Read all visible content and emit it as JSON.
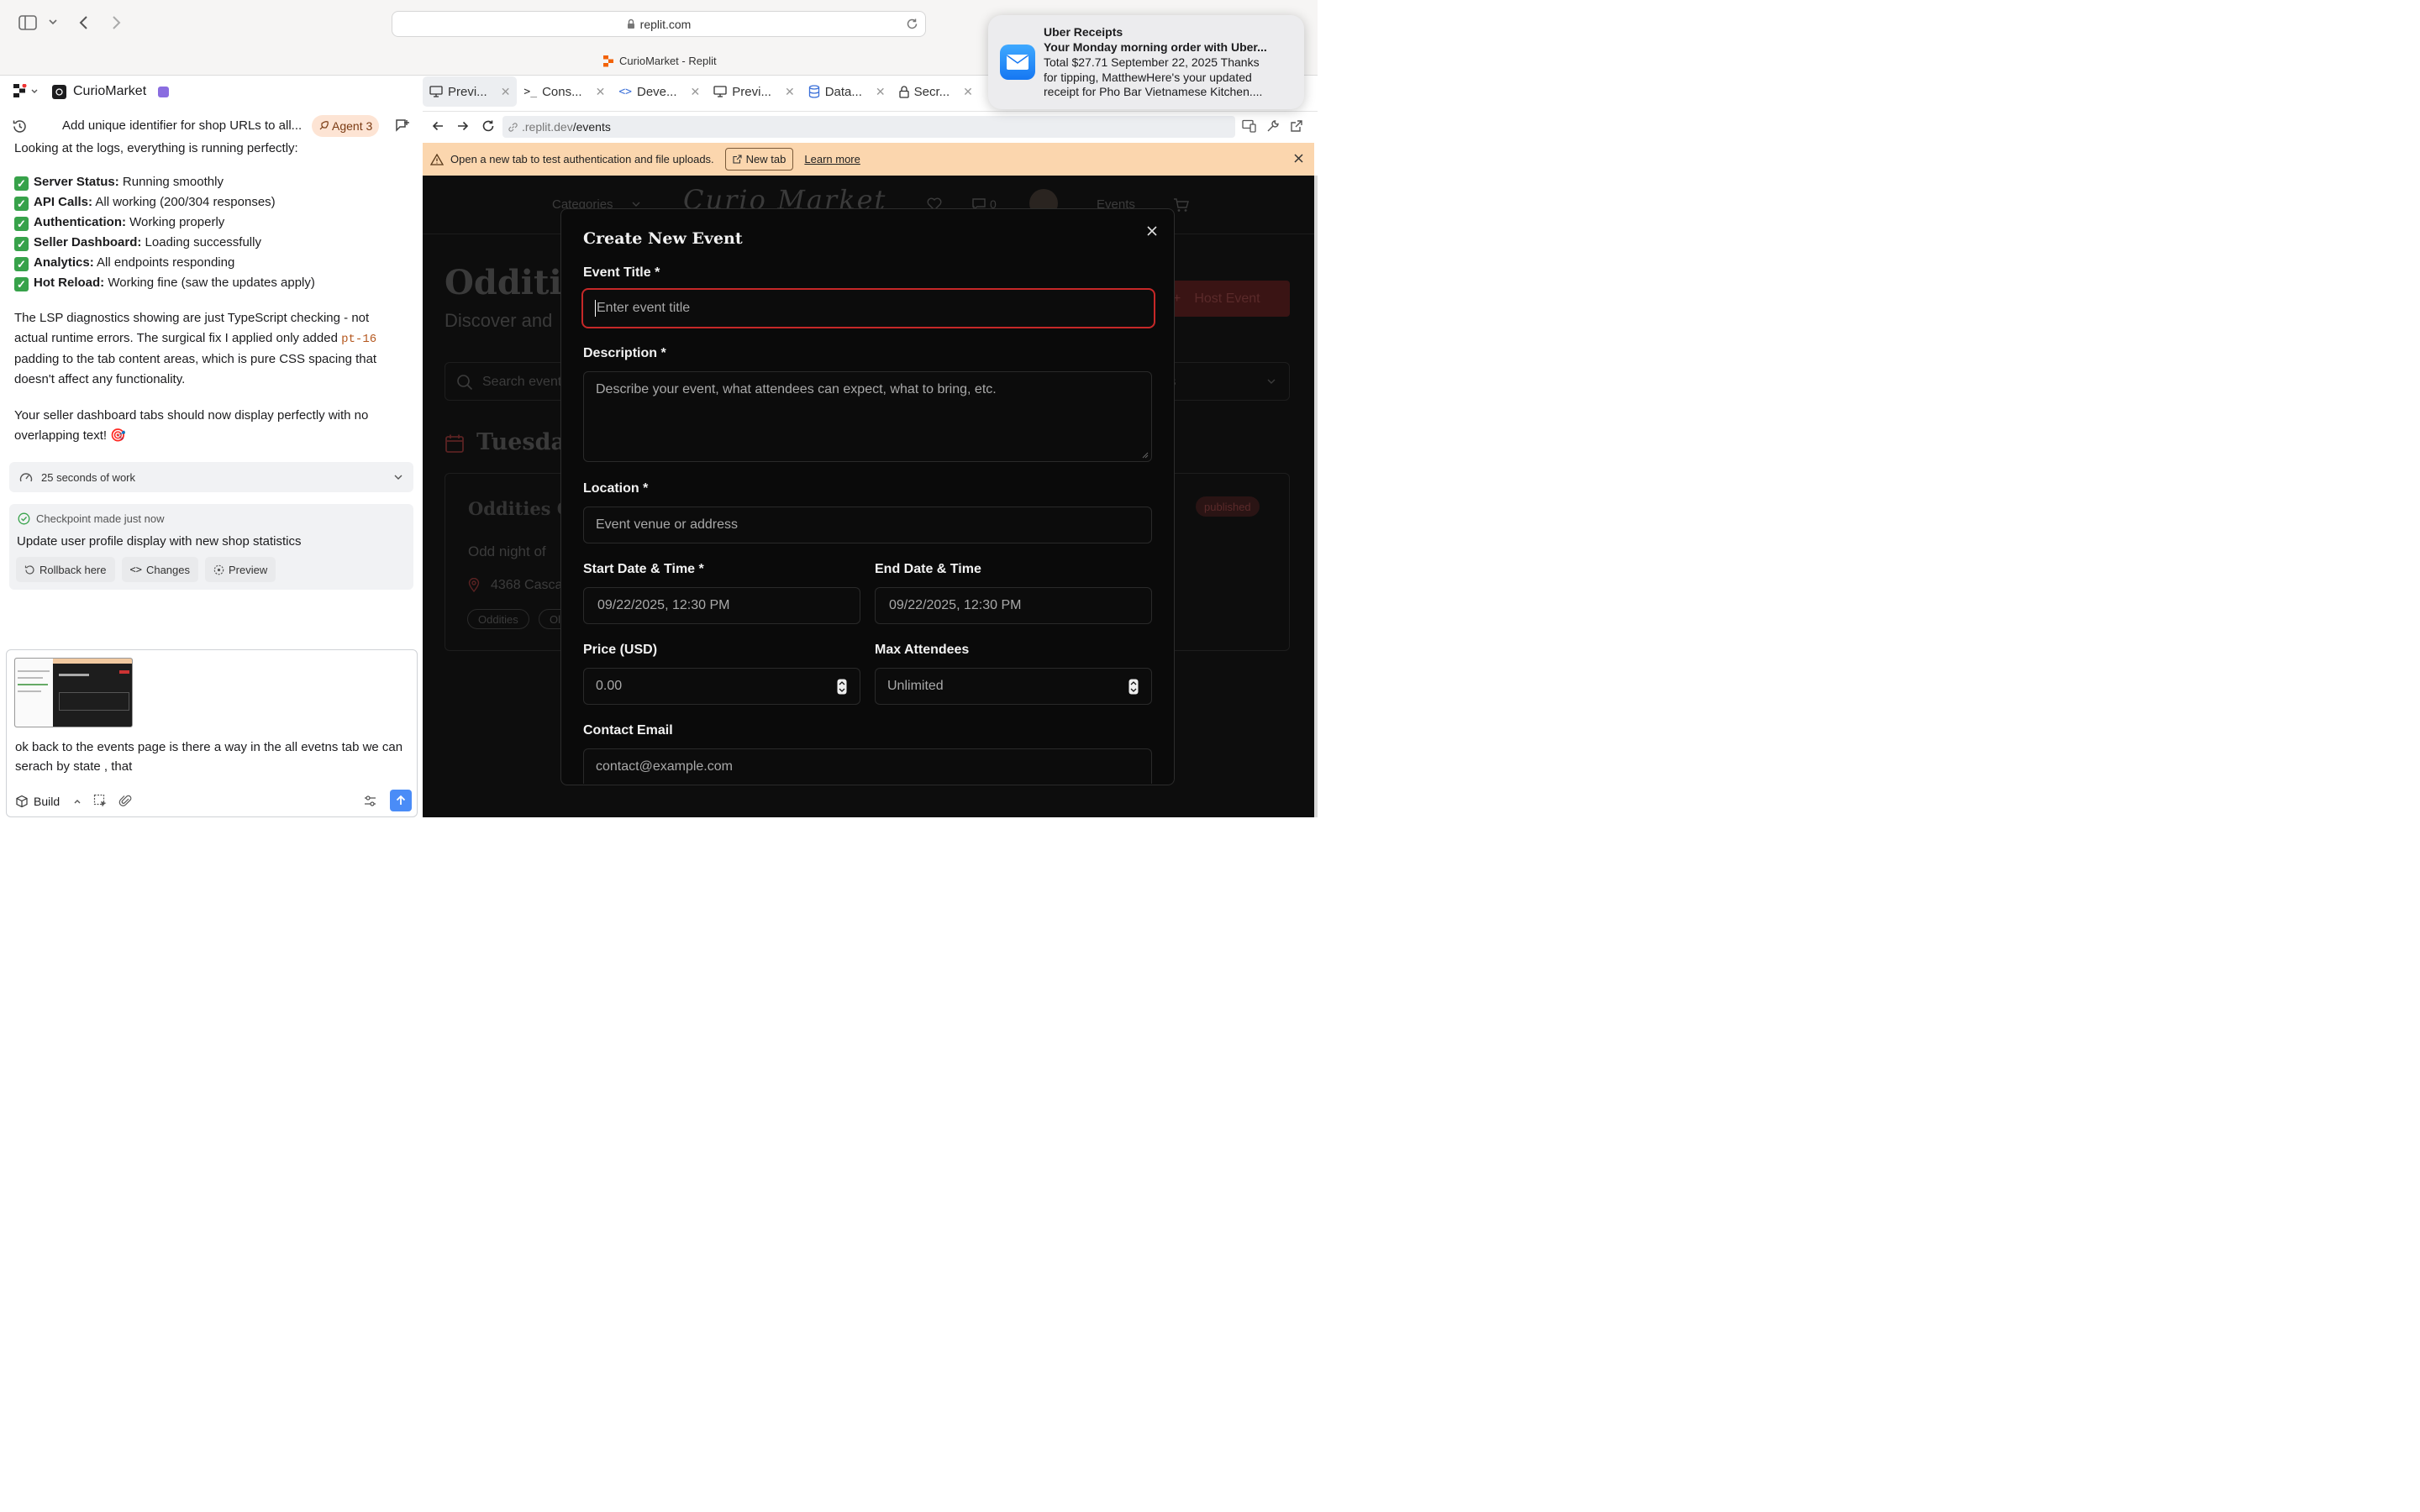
{
  "browser": {
    "address": "replit.com",
    "tab_title": "CurioMarket - Replit"
  },
  "notification": {
    "app": "Uber Receipts",
    "title": "Your Monday morning order with Uber...",
    "body_line1": "Total $27.71 September 22, 2025 Thanks",
    "body_line2": "for tipping, MatthewHere's your updated",
    "body_line3": "receipt for Pho Bar Vietnamese Kitchen...."
  },
  "project": {
    "name": "CurioMarket"
  },
  "chat": {
    "thread_title": "Add unique identifier for shop URLs to all...",
    "agent_badge": "Agent 3",
    "intro": "Looking at the logs, everything is running perfectly:",
    "checks": [
      {
        "label": "Server Status:",
        "text": "Running smoothly"
      },
      {
        "label": "API Calls:",
        "text": "All working (200/304 responses)"
      },
      {
        "label": "Authentication:",
        "text": "Working properly"
      },
      {
        "label": "Seller Dashboard:",
        "text": "Loading successfully"
      },
      {
        "label": "Analytics:",
        "text": "All endpoints responding"
      },
      {
        "label": "Hot Reload:",
        "text": "Working fine (saw the updates apply)"
      }
    ],
    "para1_a": "The LSP diagnostics showing are just TypeScript checking - not actual runtime errors. The surgical fix I applied only added",
    "para1_code": "pt-16",
    "para1_b": "padding to the tab content areas, which is pure CSS spacing that doesn't affect any functionality.",
    "para2": "Your seller dashboard tabs should now display perfectly with no overlapping text! 🎯",
    "work_summary": "25 seconds of work",
    "checkpoint_label": "Checkpoint made just now",
    "checkpoint_title": "Update user profile display with new shop statistics",
    "rollback": "Rollback here",
    "changes": "Changes",
    "preview": "Preview",
    "input_text": "ok back to the events page is there a way in the all evetns tab we can serach by state , that",
    "build_label": "Build"
  },
  "workspace": {
    "tabs": [
      "Previ...",
      "Cons...",
      "Deve...",
      "Previ...",
      "Data...",
      "Secr..."
    ],
    "url_prefix": ".replit.dev",
    "url_path": "/events",
    "banner_text": "Open a new tab to test authentication and file uploads.",
    "banner_button": "New tab",
    "banner_link": "Learn more"
  },
  "app": {
    "nav_categories": "Categories",
    "logo": "Curio Market",
    "nav_count": "0",
    "nav_events": "Events",
    "page_title": "Odditie",
    "page_sub": "Discover and",
    "host_event": "Host Event",
    "search_placeholder": "Search event",
    "filter_suffix": "ts",
    "day_heading": "Tuesday",
    "card_title": "Oddities Ol",
    "card_desc": "Odd night of",
    "card_location": "4368 Casca",
    "card_status": "published",
    "tag1": "Oddities",
    "tag2": "Ol"
  },
  "modal": {
    "title": "Create New Event",
    "event_title_label": "Event Title *",
    "event_title_placeholder": "Enter event title",
    "description_label": "Description *",
    "description_placeholder": "Describe your event, what attendees can expect, what to bring, etc.",
    "location_label": "Location *",
    "location_placeholder": "Event venue or address",
    "start_label": "Start Date & Time *",
    "start_value": "09/22/2025, 12:30 PM",
    "end_label": "End Date & Time",
    "end_value": "09/22/2025, 12:30 PM",
    "price_label": "Price (USD)",
    "price_value": "0.00",
    "max_label": "Max Attendees",
    "max_value": "Unlimited",
    "email_label": "Contact Email",
    "email_placeholder": "contact@example.com"
  },
  "colors": {
    "banner_bg": "#fbd6ae",
    "accent_red": "#c62828",
    "check_green": "#37a24a",
    "send_blue": "#4a8cf7"
  }
}
